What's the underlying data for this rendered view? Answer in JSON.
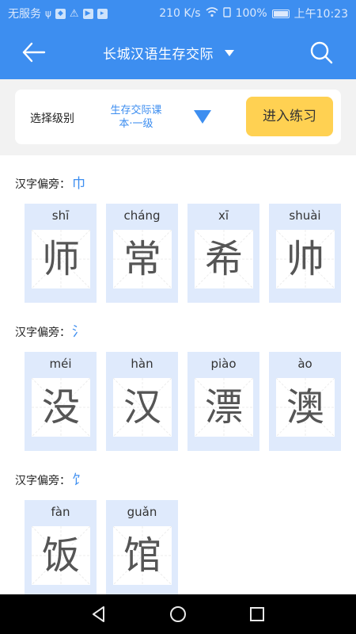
{
  "status_bar": {
    "carrier": "无服务",
    "speed": "210 K/s",
    "battery": "100%",
    "time": "上午10:23"
  },
  "header": {
    "title": "长城汉语生存交际",
    "back_icon": "arrow-left-icon",
    "search_icon": "search-icon"
  },
  "level": {
    "label": "选择级别",
    "value_line1": "生存交际课",
    "value_line2": "本·一级",
    "practice_label": "进入练习"
  },
  "sections": [
    {
      "title": "汉字偏旁：",
      "radical": "巾",
      "cards": [
        {
          "pinyin": "shī",
          "hanzi": "师"
        },
        {
          "pinyin": "cháng",
          "hanzi": "常"
        },
        {
          "pinyin": "xī",
          "hanzi": "希"
        },
        {
          "pinyin": "shuài",
          "hanzi": "帅"
        }
      ]
    },
    {
      "title": "汉字偏旁：",
      "radical": "氵",
      "cards": [
        {
          "pinyin": "méi",
          "hanzi": "没"
        },
        {
          "pinyin": "hàn",
          "hanzi": "汉"
        },
        {
          "pinyin": "piào",
          "hanzi": "漂"
        },
        {
          "pinyin": "ào",
          "hanzi": "澳"
        }
      ]
    },
    {
      "title": "汉字偏旁：",
      "radical": "饣",
      "cards": [
        {
          "pinyin": "fàn",
          "hanzi": "饭"
        },
        {
          "pinyin": "guǎn",
          "hanzi": "馆"
        }
      ]
    }
  ],
  "colors": {
    "primary": "#3d8ef0",
    "button": "#ffd152",
    "card_bg": "#dfeafc"
  }
}
